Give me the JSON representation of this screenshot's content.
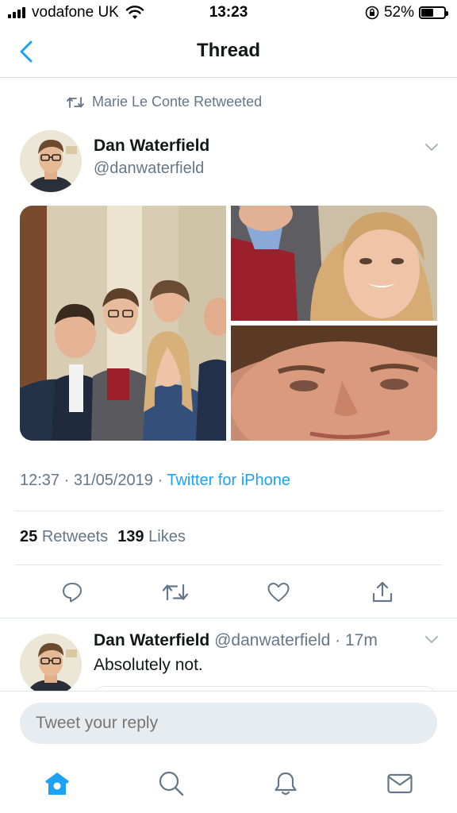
{
  "status_bar": {
    "carrier": "vodafone UK",
    "time": "13:23",
    "battery": "52%",
    "battery_level": 0.52
  },
  "nav": {
    "title": "Thread"
  },
  "tweet": {
    "retweet_context": "Marie Le Conte Retweeted",
    "author_name": "Dan Waterfield",
    "author_handle": "@danwaterfield",
    "timestamp": "12:37 · 31/05/2019 · ",
    "source": "Twitter for iPhone",
    "retweets_count": "25",
    "retweets_label": "Retweets",
    "likes_count": "139",
    "likes_label": "Likes"
  },
  "reply": {
    "author_name": "Dan Waterfield",
    "meta": " @danwaterfield · 17m",
    "text": "Absolutely not."
  },
  "compose": {
    "placeholder": "Tweet your reply"
  },
  "colors": {
    "accent": "#1da1f2",
    "secondary_text": "#657786"
  },
  "icons": {
    "back": "chevron-left-icon",
    "retweet_context": "retweet-icon",
    "caret": "chevron-down-icon",
    "reply": "reply-icon",
    "retweet": "retweet-icon",
    "like": "heart-icon",
    "share": "share-icon",
    "home": "home-icon",
    "search": "search-icon",
    "notifications": "bell-icon",
    "messages": "mail-icon"
  }
}
